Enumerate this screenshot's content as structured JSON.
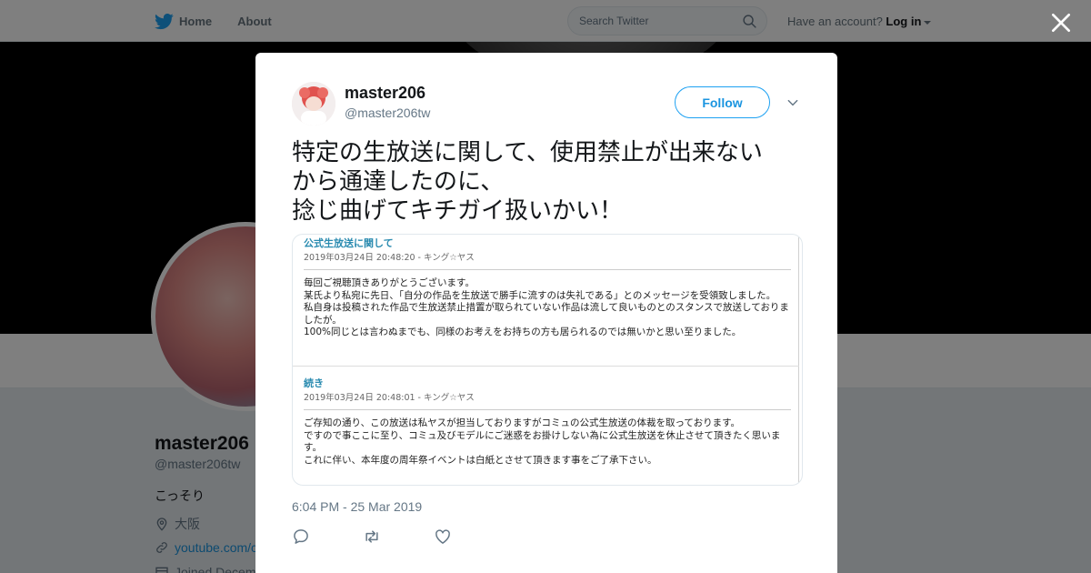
{
  "nav": {
    "home_label": "Home",
    "about_label": "About",
    "search_placeholder": "Search Twitter",
    "account_prompt": "Have an account?",
    "login_label": "Log in"
  },
  "background_profile": {
    "name": "master206",
    "handle": "@master206tw",
    "bio": "こっそり",
    "location": "大阪",
    "link": "youtube.com/c",
    "joined": "Joined Decem"
  },
  "tweet": {
    "name": "master206",
    "handle": "@master206tw",
    "follow_label": "Follow",
    "text": "特定の生放送に関して、使用禁止が出来ない\nから通達したのに、\n捻じ曲げてキチガイ扱いかい！",
    "timestamp": "6:04 PM - 25 Mar 2019"
  },
  "embedded_image": {
    "posts": [
      {
        "title": "公式生放送に関して",
        "meta": "2019年03月24日 20:48:20 - キング☆ヤス",
        "body": "毎回ご視聴頂きありがとうございます。\n某氏より私宛に先日、「自分の作品を生放送で勝手に流すのは失礼である」とのメッセージを受領致しました。\n私自身は投稿された作品で生放送禁止措置が取られていない作品は流して良いものとのスタンスで放送しておりましたが。\n100%同じとは言わぬまでも、同様のお考えをお持ちの方も居られるのでは無いかと思い至りました。"
      },
      {
        "title": "続き",
        "meta": "2019年03月24日 20:48:01 - キング☆ヤス",
        "body": "ご存知の通り、この放送は私ヤスが担当しておりますがコミュの公式生放送の体裁を取っております。\nですので事ここに至り、コミュ及びモデルにご迷惑をお掛けしない為に公式生放送を休止させて頂きたく思います。\nこれに伴い、本年度の周年祭イベントは白紙とさせて頂きます事をご了承下さい。"
      }
    ]
  },
  "colors": {
    "twitter_blue": "#1da1f2",
    "link_blue": "#1b95e0",
    "text_dark": "#14171a",
    "text_muted": "#657786"
  }
}
